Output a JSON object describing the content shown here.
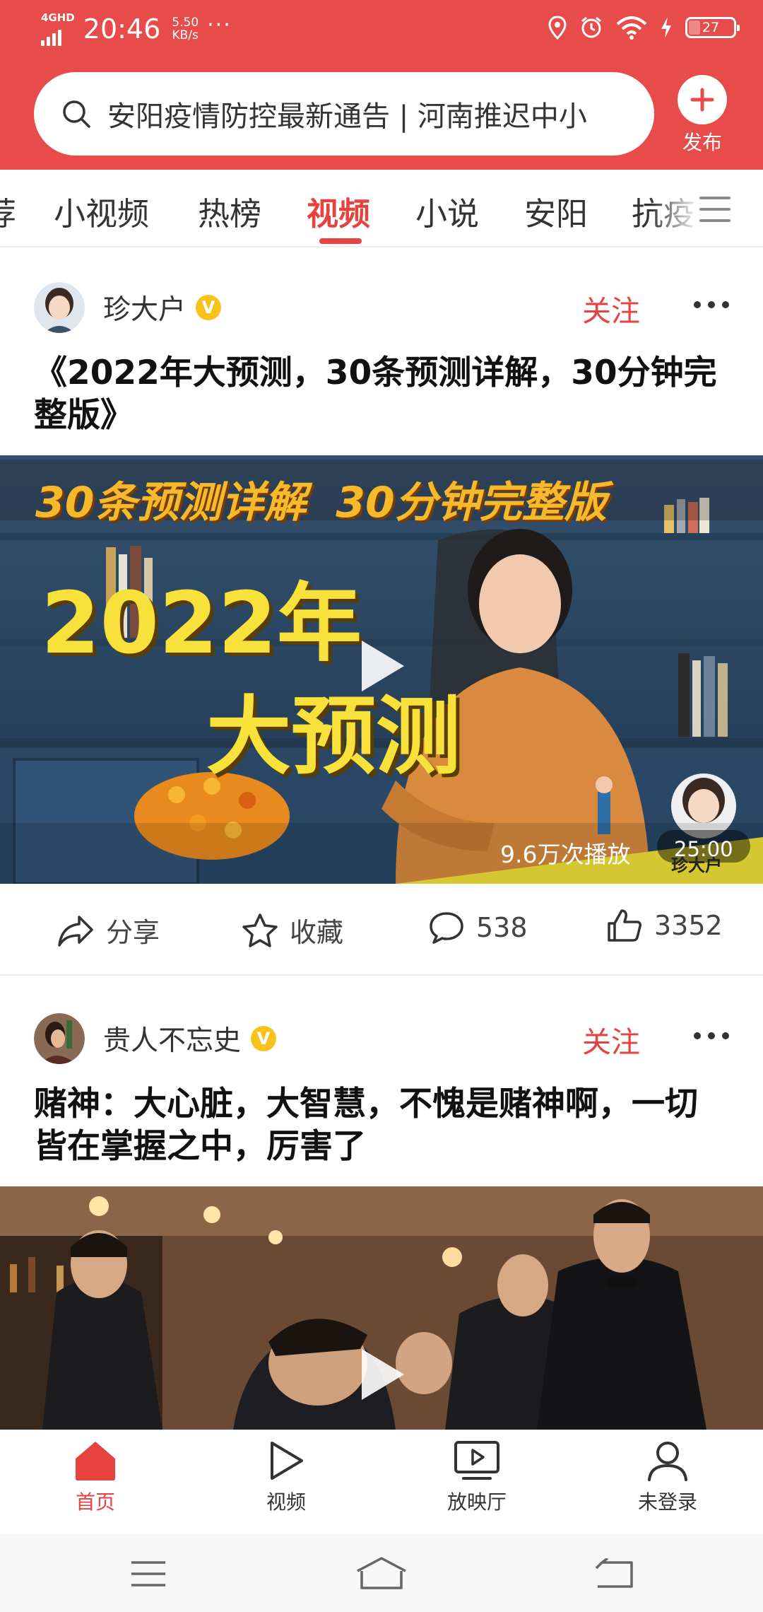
{
  "status_bar": {
    "network": "4GHD",
    "time": "20:46",
    "speed_value": "5.50",
    "speed_unit": "KB/s",
    "more": "···",
    "battery": "27"
  },
  "search": {
    "text": "安阳疫情防控最新通告 | 河南推迟中小"
  },
  "publish": {
    "label": "发布"
  },
  "tabs": [
    {
      "label": "荐"
    },
    {
      "label": "小视频"
    },
    {
      "label": "热榜"
    },
    {
      "label": "视频",
      "active": true
    },
    {
      "label": "小说"
    },
    {
      "label": "安阳"
    },
    {
      "label": "抗疫"
    }
  ],
  "posts": [
    {
      "author": "珍大户",
      "verified": "V",
      "follow": "关注",
      "title": "《2022年大预测，30条预测详解，30分钟完整版》",
      "thumb": {
        "banner": "30条预测详解  30分钟完整版",
        "big_line1": "2022年",
        "big_line2": "大预测",
        "watermark": "珍大户"
      },
      "plays": "9.6万次播放",
      "duration": "25:00",
      "actions": {
        "share": "分享",
        "collect": "收藏",
        "comments": "538",
        "likes": "3352"
      }
    },
    {
      "author": "贵人不忘史",
      "verified": "V",
      "follow": "关注",
      "title": "赌神：大心脏，大智慧，不愧是赌神啊，一切皆在掌握之中，厉害了"
    }
  ],
  "bottom_nav": [
    {
      "label": "首页",
      "icon": "home-icon",
      "active": true
    },
    {
      "label": "视频",
      "icon": "play-icon"
    },
    {
      "label": "放映厅",
      "icon": "screen-icon"
    },
    {
      "label": "未登录",
      "icon": "user-icon"
    }
  ],
  "colors": {
    "brand": "#e74b4a",
    "accent": "#e64340",
    "verified": "#f7c31a"
  }
}
